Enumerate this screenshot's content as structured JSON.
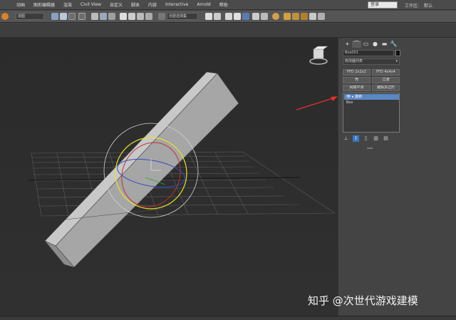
{
  "menubar": {
    "items": [
      "动画",
      "图形编辑器",
      "渲染",
      "Civil View",
      "自定义",
      "脚本",
      "内容",
      "Interactive",
      "Arnold",
      "帮助"
    ],
    "search_label": "登录",
    "workspace_label": "工作区:",
    "workspace_value": "默认"
  },
  "toolbar": {
    "view_select": "视图",
    "selection_set": "创建选择集"
  },
  "panel": {
    "tabs": [
      "+",
      "⌒",
      "▭",
      "●",
      "▬",
      "🔧"
    ],
    "object_name": "Box001",
    "modifier_list": "修改器列表",
    "buttons": [
      {
        "label": "FFD 2x2x2"
      },
      {
        "label": "FFD 4x4x4"
      },
      {
        "label": "壳"
      },
      {
        "label": "过渡"
      },
      {
        "label": "网格平滑"
      },
      {
        "label": "编辑多边形"
      }
    ],
    "stack": [
      {
        "label": "旋转",
        "selected": true
      },
      {
        "label": "Box",
        "selected": false
      }
    ]
  },
  "watermark": "知乎 @次世代游戏建模",
  "colors": {
    "selection_blue": "#5b87c4",
    "arrow_red": "#e03030",
    "gizmo_yellow": "#e8e030"
  }
}
